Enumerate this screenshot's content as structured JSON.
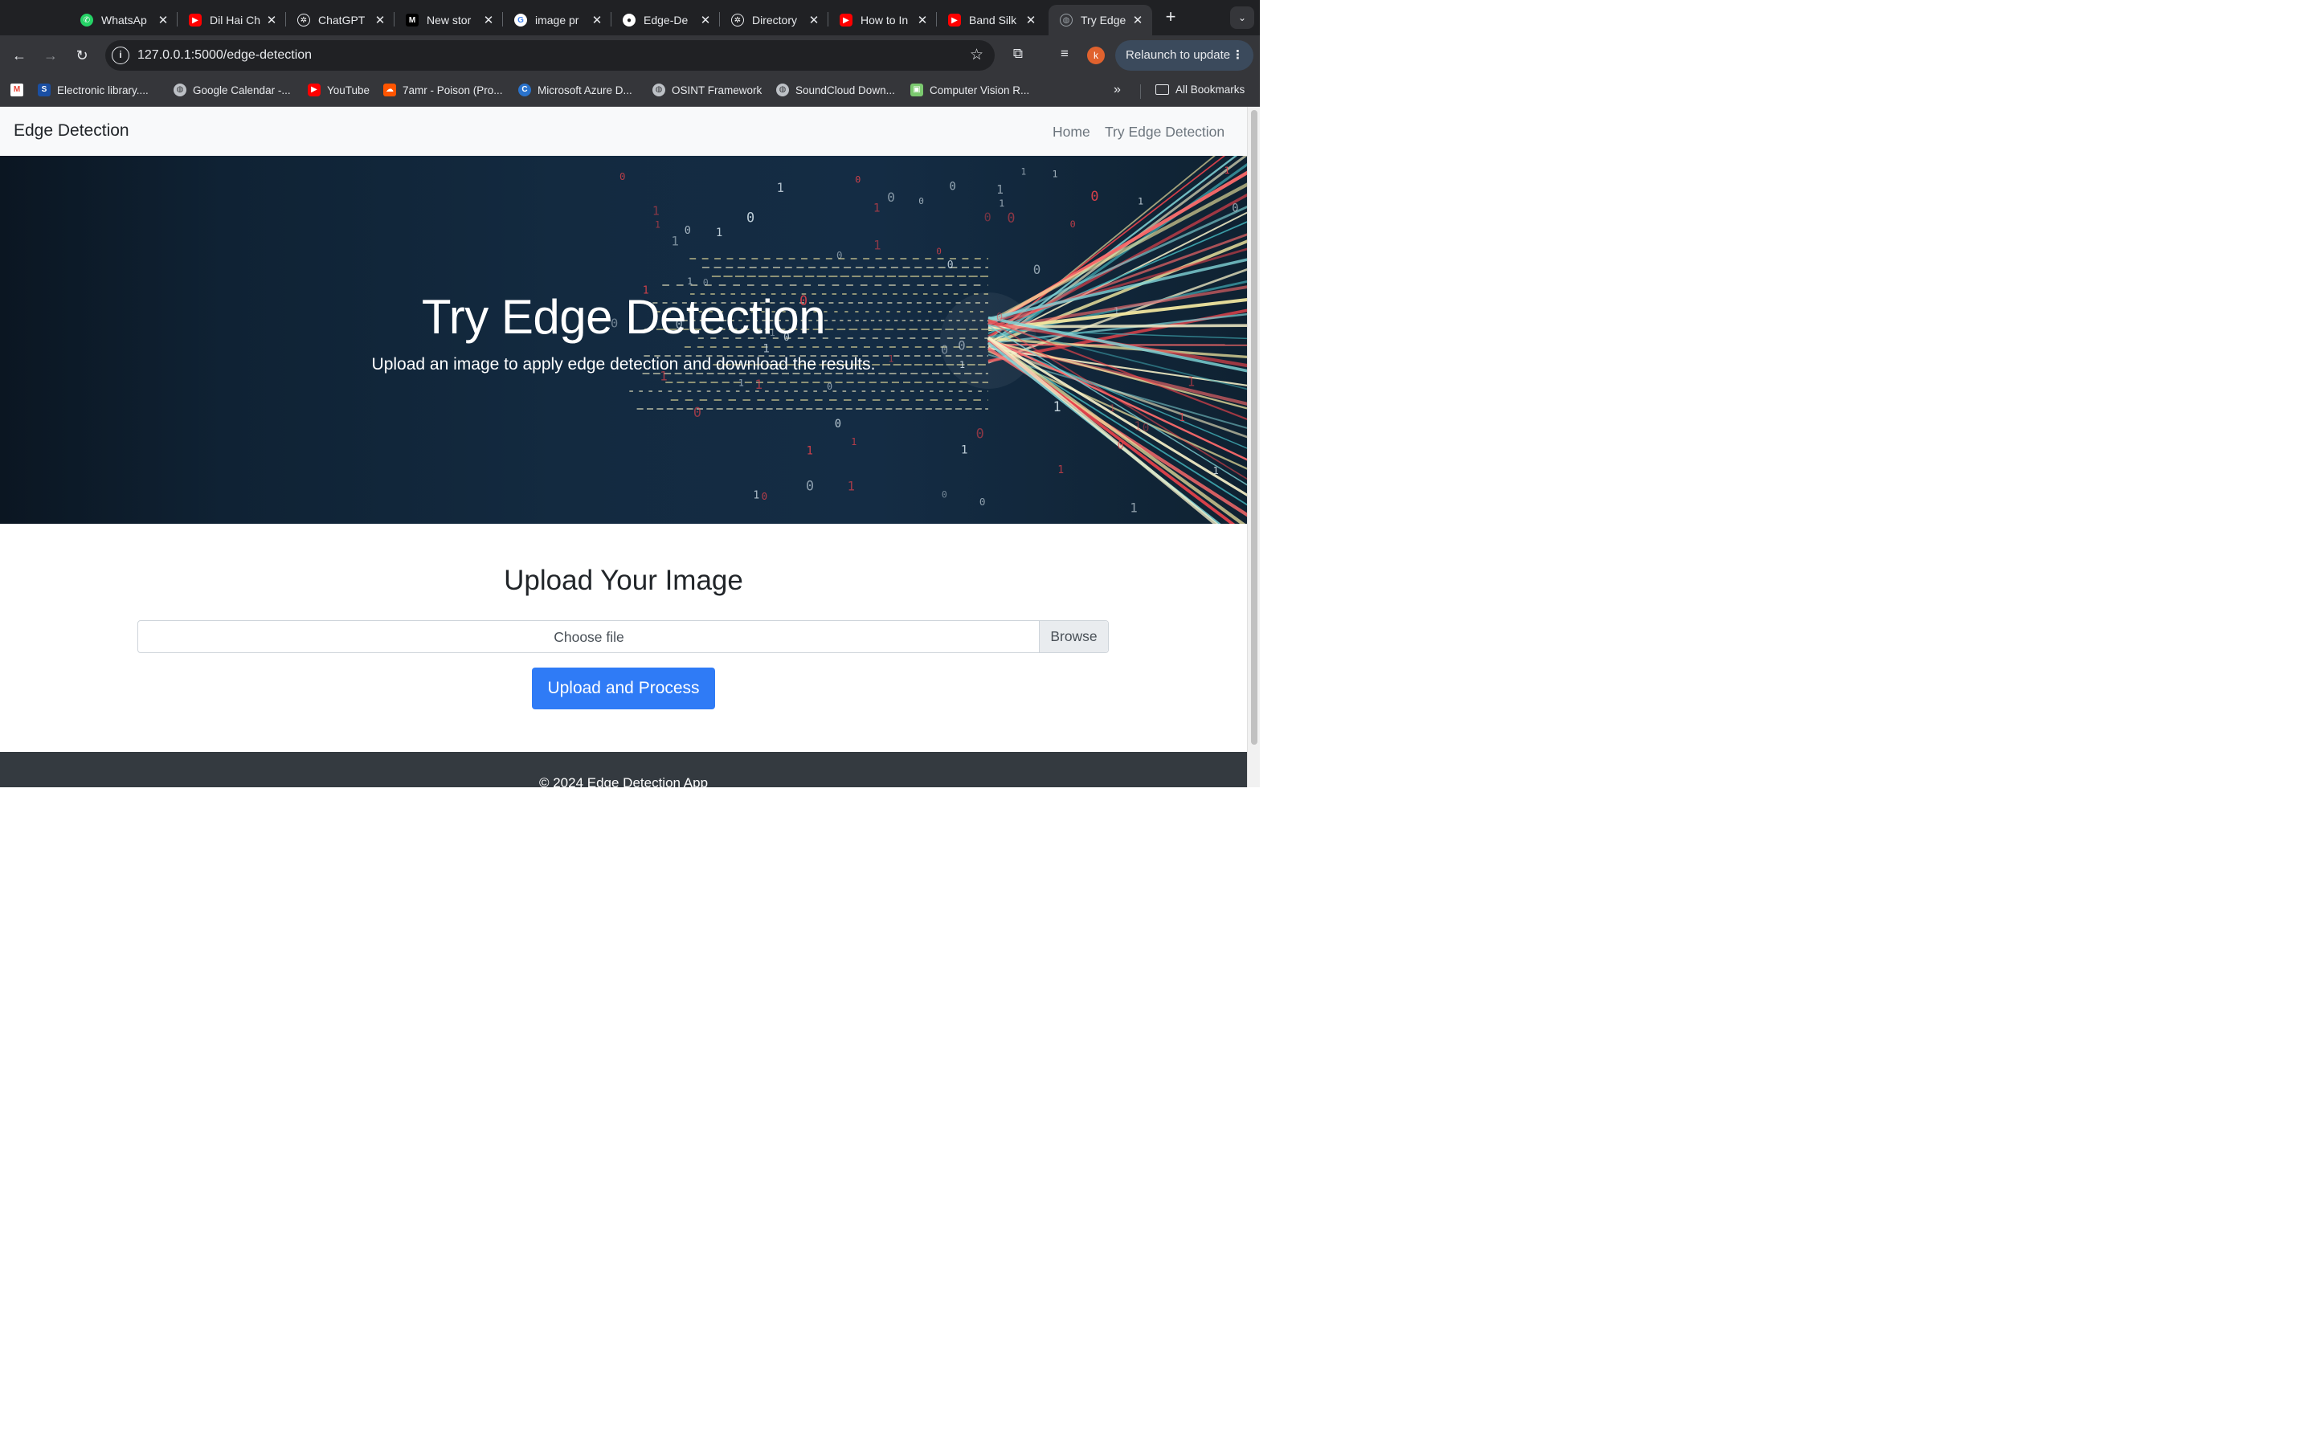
{
  "browser": {
    "tabs": [
      {
        "title": "WhatsAp",
        "icon": "whatsapp-icon",
        "color": "#25d366"
      },
      {
        "title": "Dil Hai Ch",
        "icon": "youtube-icon",
        "color": "#ff0000"
      },
      {
        "title": "ChatGPT",
        "icon": "openai-icon",
        "color": "#202124"
      },
      {
        "title": "New stor",
        "icon": "medium-icon",
        "color": "#000000"
      },
      {
        "title": "image pr",
        "icon": "google-icon",
        "color": "#ffffff"
      },
      {
        "title": "Edge-De",
        "icon": "github-icon",
        "color": "#202124"
      },
      {
        "title": "Directory",
        "icon": "openai-icon",
        "color": "#202124"
      },
      {
        "title": "How to In",
        "icon": "youtube-icon",
        "color": "#ff0000"
      },
      {
        "title": "Band Silk",
        "icon": "youtube-icon",
        "color": "#ff0000"
      },
      {
        "title": "Try Edge",
        "icon": "globe-icon",
        "color": "#9aa0a6"
      }
    ],
    "url": "127.0.0.1:5000/edge-detection",
    "profile_initial": "k",
    "relaunch_label": "Relaunch to update",
    "bookmarks": [
      {
        "label": "",
        "icon": "gmail-icon"
      },
      {
        "label": "Electronic library....",
        "icon": "library-icon"
      },
      {
        "label": "Google Calendar -...",
        "icon": "globe-icon"
      },
      {
        "label": "YouTube",
        "icon": "youtube-icon"
      },
      {
        "label": "7amr - Poison (Pro...",
        "icon": "soundcloud-icon"
      },
      {
        "label": "Microsoft Azure D...",
        "icon": "coursera-icon"
      },
      {
        "label": "OSINT Framework",
        "icon": "globe-icon"
      },
      {
        "label": "SoundCloud Down...",
        "icon": "globe-icon"
      },
      {
        "label": "Computer Vision R...",
        "icon": "image-icon"
      }
    ],
    "all_bookmarks_label": "All Bookmarks"
  },
  "page": {
    "brand": "Edge Detection",
    "nav": [
      "Home",
      "Try Edge Detection"
    ],
    "hero_title": "Try Edge Detection",
    "hero_subtitle": "Upload an image to apply edge detection and download the results.",
    "upload_heading": "Upload Your Image",
    "file_placeholder": "Choose file",
    "browse_label": "Browse",
    "submit_label": "Upload and Process",
    "footer": "© 2024 Edge Detection App"
  },
  "colors": {
    "primary": "#2f7bf6",
    "footer_bg": "#343a40",
    "navbar_bg": "#f8f9fa"
  }
}
